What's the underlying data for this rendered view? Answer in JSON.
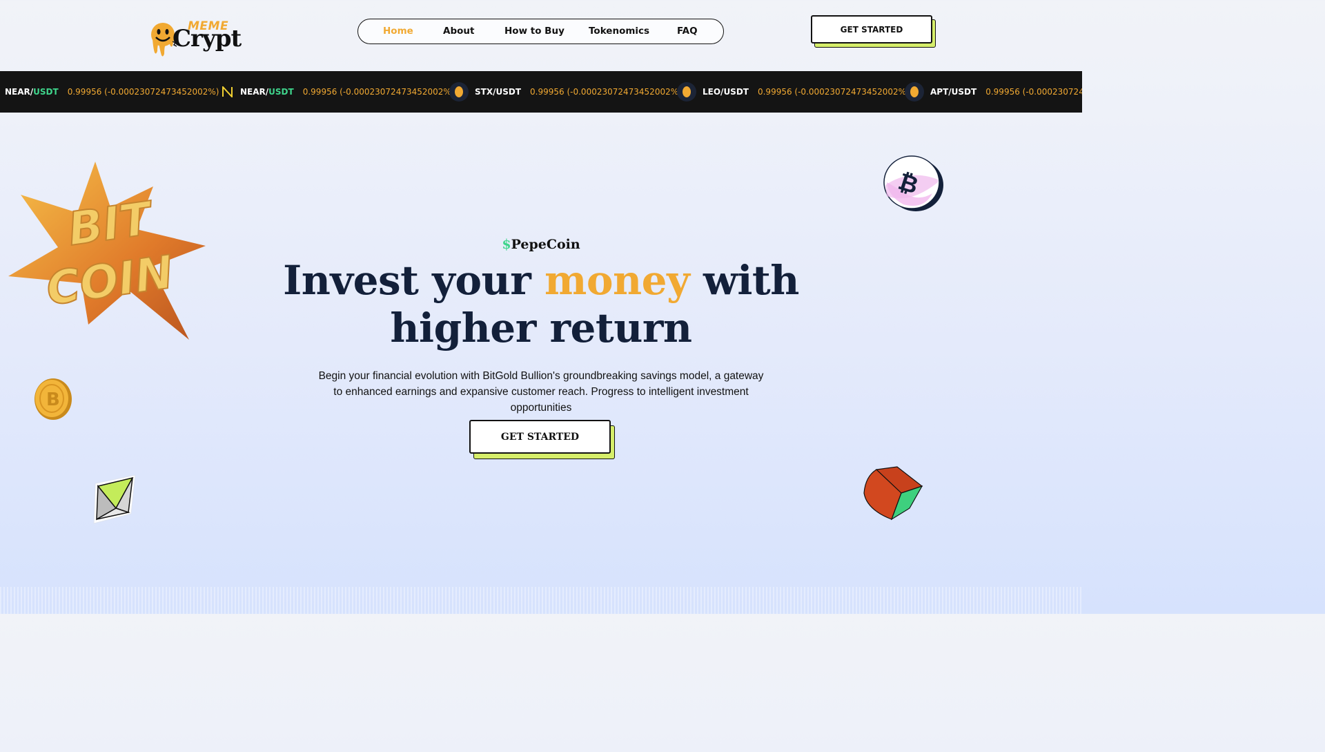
{
  "header": {
    "logo": {
      "top_word": "MEME",
      "main_word": "Crypt"
    },
    "nav": [
      {
        "label": "Home",
        "active": true
      },
      {
        "label": "About",
        "active": false
      },
      {
        "label": "How to Buy",
        "active": false
      },
      {
        "label": "Tokenomics",
        "active": false
      },
      {
        "label": "FAQ",
        "active": false
      }
    ],
    "cta_label": "GET STARTED"
  },
  "ticker": [
    {
      "base": "NEAR",
      "sep": "/",
      "quote": "USDT",
      "price": "0.99956 (-0.00023072473452002%)",
      "icon": "none"
    },
    {
      "base": "NEAR",
      "sep": "/",
      "quote": "USDT",
      "price": "0.99956 (-0.00023072473452002%)",
      "icon": "near-icon"
    },
    {
      "base": "STX",
      "sep": "/",
      "quote": "USDT",
      "price": "0.99956 (-0.00023072473452002%)",
      "icon": "coin-icon"
    },
    {
      "base": "LEO",
      "sep": "/",
      "quote": "USDT",
      "price": "0.99956 (-0.00023072473452002%)",
      "icon": "coin-icon"
    },
    {
      "base": "APT",
      "sep": "/",
      "quote": "USDT",
      "price": "0.99956 (-0.0002307247",
      "icon": "coin-icon"
    }
  ],
  "hero": {
    "eyebrow_symbol": "$",
    "eyebrow_text": "PepeCoin",
    "headline_part1": "Invest your ",
    "headline_accent": "money",
    "headline_part2": " with",
    "headline_line2": "higher return",
    "lede": "Begin your financial evolution with BitGold Bullion's groundbreaking savings model, a gateway to enhanced earnings and expansive customer reach. Progress to intelligent investment opportunities",
    "cta_label": "GET STARTED"
  },
  "decorations": {
    "starburst_text": [
      "BIT",
      "COIN"
    ],
    "coin_symbol": "B",
    "bitcoin_symbol": "₿"
  },
  "colors": {
    "accent": "#f1a932",
    "green": "#3fd58c",
    "lime": "#d6ee6a",
    "navy": "#13203a",
    "ticker_bg": "#141414"
  }
}
